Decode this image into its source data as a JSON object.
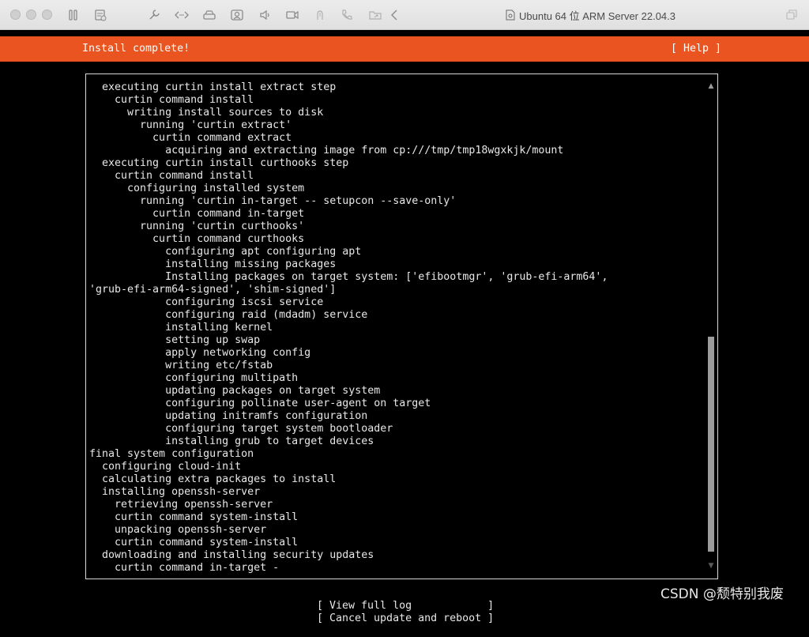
{
  "window": {
    "title": "Ubuntu 64 位 ARM Server 22.04.3",
    "icons": [
      "pause-icon",
      "snapshot-icon",
      "settings-wrench-icon",
      "code-icon",
      "disk-icon",
      "camera-icon",
      "sound-icon",
      "video-icon",
      "usb-icon",
      "phone-icon",
      "folder-share-icon",
      "back-chevron-icon",
      "restore-icon"
    ]
  },
  "installer": {
    "banner_title": "Install complete!",
    "help_label": "[ Help ]",
    "log_lines": [
      "  executing curtin install extract step",
      "    curtin command install",
      "      writing install sources to disk",
      "        running 'curtin extract'",
      "          curtin command extract",
      "            acquiring and extracting image from cp:///tmp/tmp18wgxkjk/mount",
      "  executing curtin install curthooks step",
      "    curtin command install",
      "      configuring installed system",
      "        running 'curtin in-target -- setupcon --save-only'",
      "          curtin command in-target",
      "        running 'curtin curthooks'",
      "          curtin command curthooks",
      "            configuring apt configuring apt",
      "            installing missing packages",
      "            Installing packages on target system: ['efibootmgr', 'grub-efi-arm64',",
      "'grub-efi-arm64-signed', 'shim-signed']",
      "            configuring iscsi service",
      "            configuring raid (mdadm) service",
      "            installing kernel",
      "            setting up swap",
      "            apply networking config",
      "            writing etc/fstab",
      "            configuring multipath",
      "            updating packages on target system",
      "            configuring pollinate user-agent on target",
      "            updating initramfs configuration",
      "            configuring target system bootloader",
      "            installing grub to target devices",
      "final system configuration",
      "  configuring cloud-init",
      "  calculating extra packages to install",
      "  installing openssh-server",
      "    retrieving openssh-server",
      "    curtin command system-install",
      "    unpacking openssh-server",
      "    curtin command system-install",
      "  downloading and installing security updates",
      "    curtin command in-target -"
    ],
    "scroll_up_glyph": "▲",
    "scroll_down_glyph": "▼",
    "scroll_position": {
      "thumb_start_fraction": 0.52,
      "thumb_end_fraction": 0.98
    },
    "buttons": [
      "[ View full log            ]",
      "[ Cancel update and reboot ]"
    ]
  },
  "watermark": "CSDN @颓特别我废",
  "colors": {
    "banner": "#e95420",
    "screen_bg": "#000000",
    "text": "#e8e8e8"
  }
}
